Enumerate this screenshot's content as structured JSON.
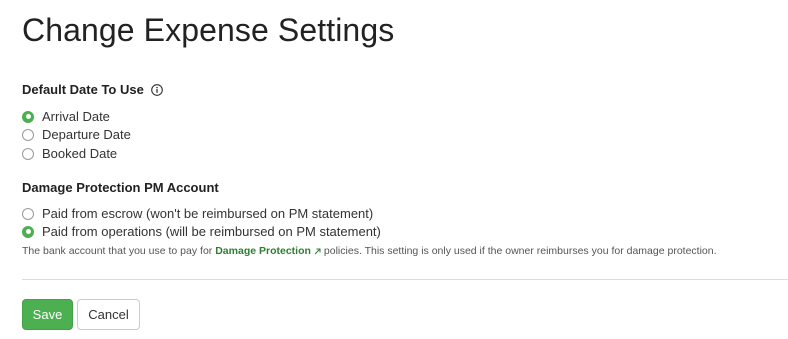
{
  "page": {
    "title": "Change Expense Settings"
  },
  "default_date": {
    "label": "Default Date To Use",
    "icon": "info-icon",
    "options": [
      {
        "label": "Arrival Date",
        "checked": true
      },
      {
        "label": "Departure Date",
        "checked": false
      },
      {
        "label": "Booked Date",
        "checked": false
      }
    ]
  },
  "damage_protection": {
    "label": "Damage Protection PM Account",
    "options": [
      {
        "label": "Paid from escrow (won't be reimbursed on PM statement)",
        "checked": false
      },
      {
        "label": "Paid from operations (will be reimbursed on PM statement)",
        "checked": true
      }
    ],
    "help_prefix": "The bank account that you use to pay for",
    "help_link": "Damage Protection",
    "help_link_icon": "external-link-icon",
    "help_suffix": "policies. This setting is only used if the owner reimburses you for damage protection."
  },
  "actions": {
    "save_label": "Save",
    "cancel_label": "Cancel"
  },
  "colors": {
    "accent": "#4caf50",
    "link": "#2e7d32",
    "divider": "#dddddd"
  }
}
